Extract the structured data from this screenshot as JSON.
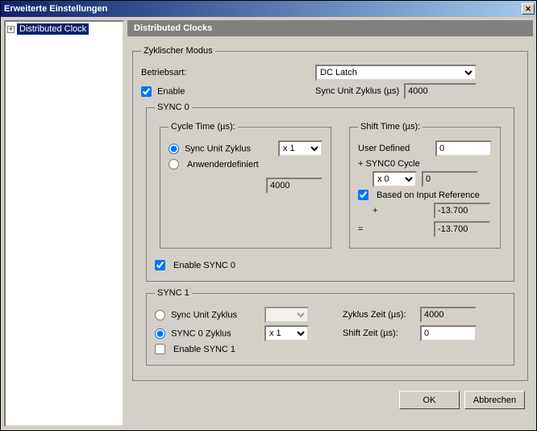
{
  "window": {
    "title": "Erweiterte Einstellungen"
  },
  "tree": {
    "item0": "Distributed Clock"
  },
  "page": {
    "title": "Distributed Clocks"
  },
  "cyclic": {
    "legend": "Zyklischer Modus",
    "mode_label": "Betriebsart:",
    "mode_value": "DC Latch",
    "enable_label": "Enable",
    "sync_unit_label": "Sync Unit Zyklus (µs)",
    "sync_unit_value": "4000"
  },
  "sync0": {
    "legend": "SYNC 0",
    "cycle": {
      "legend": "Cycle Time (µs):",
      "opt_syncunit": "Sync Unit Zyklus",
      "opt_user": "Anwenderdefiniert",
      "mult": "x 1",
      "value": "4000"
    },
    "shift": {
      "legend": "Shift Time (µs):",
      "user_defined": "User Defined",
      "user_value": "0",
      "plus_cycle": "+ SYNC0 Cycle",
      "plus_mult": "x 0",
      "plus_value": "0",
      "based_on": "Based on Input Reference",
      "plus_sign": "+",
      "plus_val": "-13.700",
      "eq_sign": "=",
      "eq_val": "-13.700"
    },
    "enable_label": "Enable SYNC 0"
  },
  "sync1": {
    "legend": "SYNC 1",
    "opt_syncunit": "Sync Unit Zyklus",
    "opt_sync0": "SYNC 0 Zyklus",
    "mult": "x 1",
    "cycle_label": "Zyklus Zeit (µs):",
    "cycle_value": "4000",
    "shift_label": "Shift Zeit (µs):",
    "shift_value": "0",
    "enable_label": "Enable SYNC 1"
  },
  "buttons": {
    "ok": "OK",
    "cancel": "Abbrechen"
  }
}
